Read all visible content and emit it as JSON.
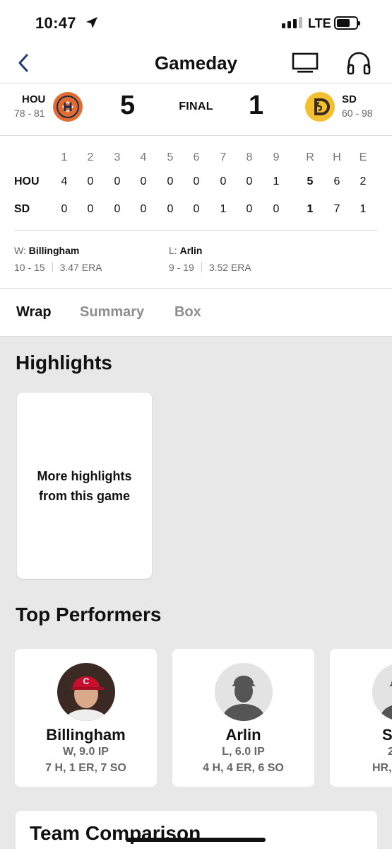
{
  "status": {
    "time": "10:47",
    "network": "LTE"
  },
  "nav": {
    "title": "Gameday"
  },
  "score": {
    "away": {
      "abbr": "HOU",
      "record": "78 - 81",
      "runs": "5",
      "color": "#e26c2f"
    },
    "home": {
      "abbr": "SD",
      "record": "60 - 98",
      "runs": "1",
      "color": "#f3c02f"
    },
    "status": "FINAL"
  },
  "linescore": {
    "innings": [
      "1",
      "2",
      "3",
      "4",
      "5",
      "6",
      "7",
      "8",
      "9"
    ],
    "totals_headers": [
      "R",
      "H",
      "E"
    ],
    "rows": [
      {
        "team": "HOU",
        "innings": [
          "4",
          "0",
          "0",
          "0",
          "0",
          "0",
          "0",
          "0",
          "1"
        ],
        "totals": [
          "5",
          "6",
          "2"
        ]
      },
      {
        "team": "SD",
        "innings": [
          "0",
          "0",
          "0",
          "0",
          "0",
          "0",
          "1",
          "0",
          "0"
        ],
        "totals": [
          "1",
          "7",
          "1"
        ]
      }
    ]
  },
  "decisions": {
    "win": {
      "label": "W:",
      "name": "Billingham",
      "record": "10 - 15",
      "era": "3.47 ERA"
    },
    "loss": {
      "label": "L:",
      "name": "Arlin",
      "record": "9 - 19",
      "era": "3.52 ERA"
    }
  },
  "tabs": [
    "Wrap",
    "Summary",
    "Box"
  ],
  "highlights": {
    "title": "Highlights",
    "card": "More highlights from this game"
  },
  "performers": {
    "title": "Top Performers",
    "cards": [
      {
        "name": "Billingham",
        "line1": "W, 9.0 IP",
        "line2": "7 H, 1 ER, 7 SO"
      },
      {
        "name": "Arlin",
        "line1": "L, 6.0 IP",
        "line2": "4 H, 4 ER, 6 SO"
      },
      {
        "name": "S",
        "line1": "2",
        "line2": "HR,"
      }
    ]
  },
  "team_comparison": {
    "title": "Team Comparison"
  }
}
